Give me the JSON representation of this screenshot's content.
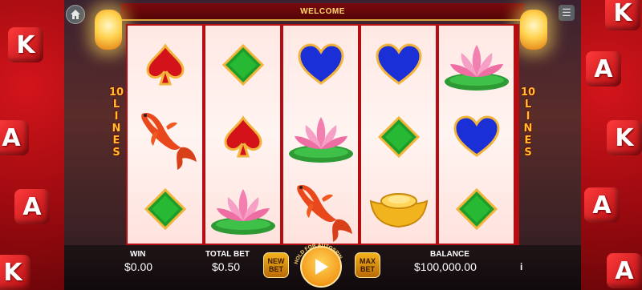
{
  "header": {
    "title": "WELCOME"
  },
  "side_text": {
    "left": [
      "10",
      "L",
      "I",
      "N",
      "E",
      "S"
    ],
    "right": [
      "10",
      "L",
      "I",
      "N",
      "E",
      "S"
    ]
  },
  "dice": {
    "letters": [
      "K",
      "A"
    ]
  },
  "reels": [
    [
      "red-spade",
      "koi-fish",
      "green-diamond"
    ],
    [
      "green-diamond",
      "red-spade",
      "pink-lotus"
    ],
    [
      "blue-heart",
      "pink-lotus",
      "koi-fish"
    ],
    [
      "blue-heart",
      "green-diamond",
      "gold-ingot"
    ],
    [
      "pink-lotus",
      "blue-heart",
      "green-diamond"
    ]
  ],
  "footer": {
    "win_label": "WIN",
    "win_value": "$0.00",
    "total_bet_label": "TOTAL BET",
    "total_bet_value": "$0.50",
    "new_bet_label": "NEW BET",
    "hold_text": "HOLD FOR AUTOSPIN",
    "max_bet_label": "MAX BET",
    "balance_label": "BALANCE",
    "balance_value": "$100,000.00",
    "info_label": "i"
  },
  "colors": {
    "frame": "#b40d12",
    "accent_gold": "#ffbf2e",
    "reel_bg": "#fff4f1"
  }
}
